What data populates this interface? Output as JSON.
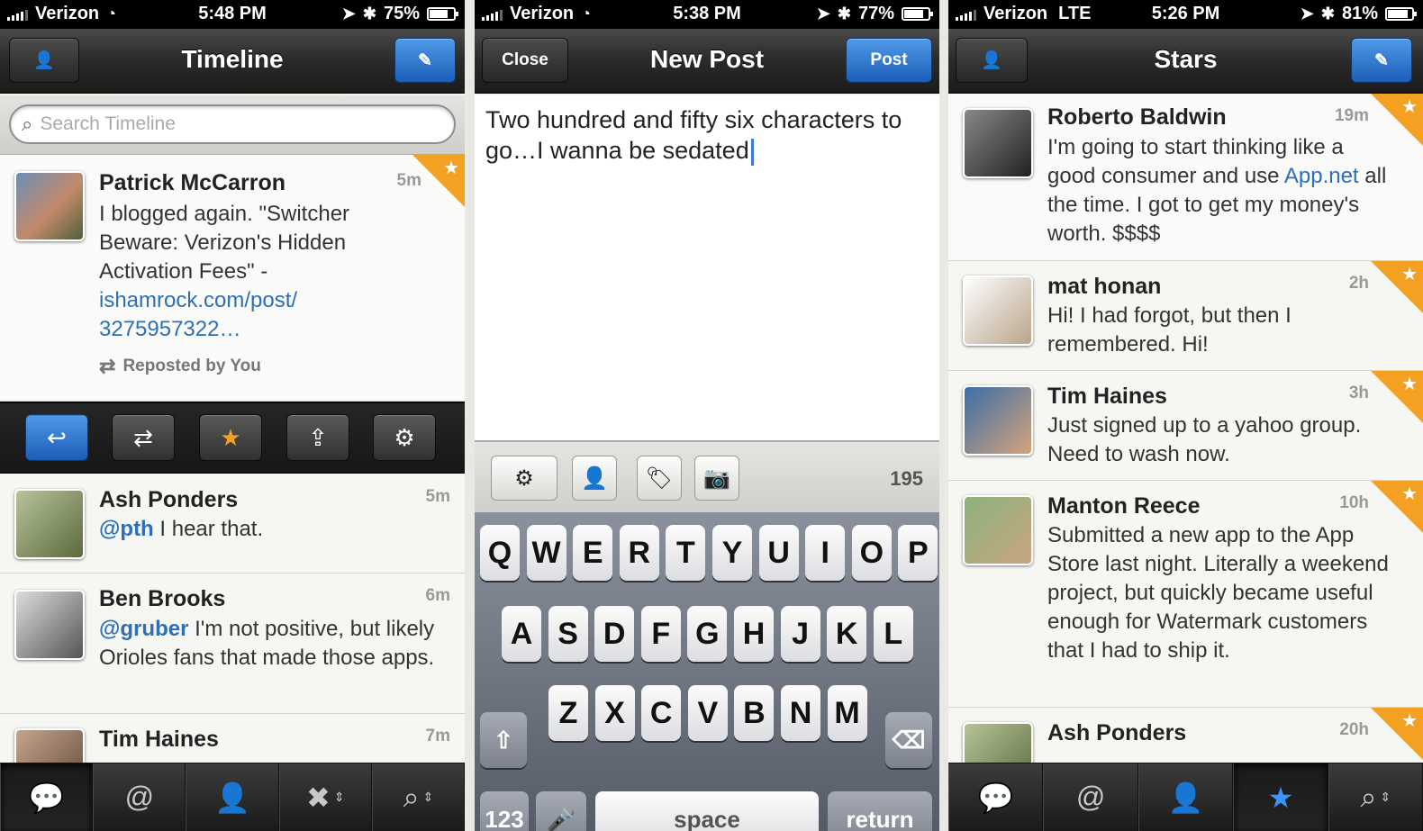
{
  "screens": [
    {
      "status": {
        "carrier": "Verizon",
        "network": "",
        "time": "5:48 PM",
        "battery": "75%"
      },
      "nav": {
        "title": "Timeline"
      },
      "search": {
        "placeholder": "Search Timeline"
      },
      "posts": [
        {
          "name": "Patrick McCarron",
          "age": "5m",
          "text": "I blogged again. \"Switcher Beware: Verizon's Hidden Activation Fees\" - ",
          "link": "ishamrock.com/post/ 3275957322…",
          "starred": true,
          "repost": "Reposted by You"
        },
        {
          "name": "Ash Ponders",
          "age": "5m",
          "mention": "@pth",
          "text": " I hear that."
        },
        {
          "name": "Ben Brooks",
          "age": "6m",
          "mention": "@gruber",
          "text": " I'm not positive, but likely Orioles fans that made those apps."
        },
        {
          "name": "Tim Haines",
          "age": "7m",
          "text": ""
        }
      ],
      "tabs": [
        "chat-icon",
        "at-icon",
        "person-icon",
        "messages-icon",
        "search-icon"
      ]
    },
    {
      "status": {
        "carrier": "Verizon",
        "network": "",
        "time": "5:38 PM",
        "battery": "77%"
      },
      "nav": {
        "title": "New Post",
        "left": "Close",
        "right": "Post"
      },
      "compose": {
        "text": "Two hundred and fifty six characters to go…I wanna be sedated",
        "count": "195"
      },
      "keyboard": {
        "row1": [
          "Q",
          "W",
          "E",
          "R",
          "T",
          "Y",
          "U",
          "I",
          "O",
          "P"
        ],
        "row2": [
          "A",
          "S",
          "D",
          "F",
          "G",
          "H",
          "J",
          "K",
          "L"
        ],
        "row3": [
          "Z",
          "X",
          "C",
          "V",
          "B",
          "N",
          "M"
        ],
        "numbers": "123",
        "space": "space",
        "return": "return"
      }
    },
    {
      "status": {
        "carrier": "Verizon",
        "network": "LTE",
        "time": "5:26 PM",
        "battery": "81%"
      },
      "nav": {
        "title": "Stars"
      },
      "posts": [
        {
          "name": "Roberto Baldwin",
          "age": "19m",
          "text": "I'm going to start thinking like a good consumer and use ",
          "link": "App.net",
          "text2": " all the time. I got to get my money's worth. $$$$"
        },
        {
          "name": "mat honan",
          "age": "2h",
          "text": "Hi! I had forgot, but then I remembered. Hi!"
        },
        {
          "name": "Tim Haines",
          "age": "3h",
          "text": "Just signed up to a yahoo group. Need to wash now."
        },
        {
          "name": "Manton Reece",
          "age": "10h",
          "text": "Submitted a new app to the App Store last night. Literally a weekend project, but quickly became useful enough for Watermark customers that I had to ship it."
        },
        {
          "name": "Ash Ponders",
          "age": "20h",
          "text": ""
        }
      ]
    }
  ],
  "colors": {
    "accent": "#2b70b8",
    "star": "#f4a123",
    "tabActive": "#3a95ff",
    "navBlue": "#1c5eb8"
  }
}
